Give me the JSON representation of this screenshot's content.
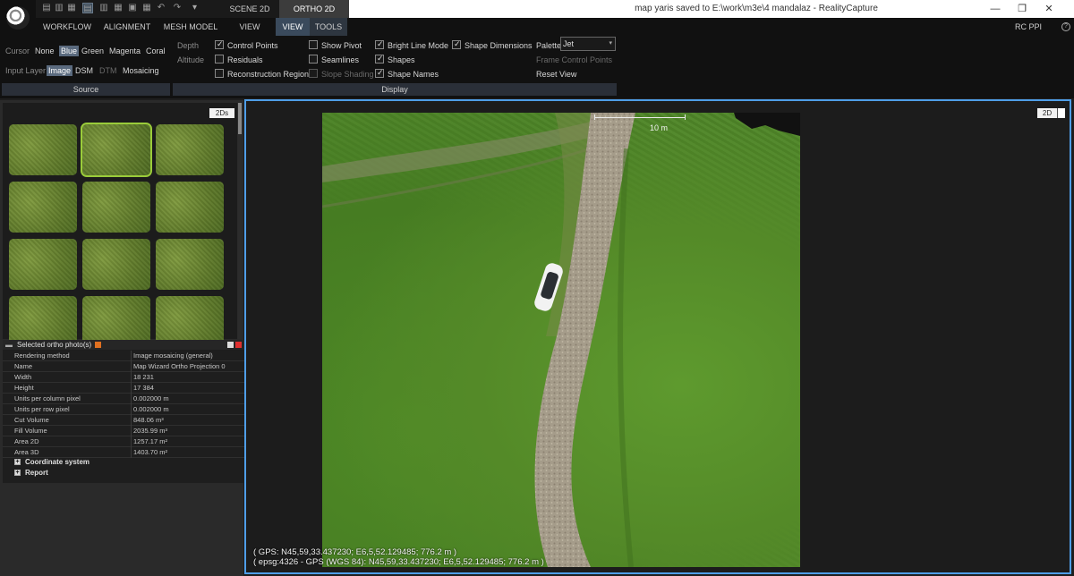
{
  "app": {
    "window_title": "map yaris saved to E:\\work\\m3e\\4 mandalaz - RealityCapture",
    "doc_tabs": [
      "SCENE 2D",
      "ORTHO 2D"
    ],
    "window_controls": {
      "minimize": "—",
      "restore": "❐",
      "close": "✕"
    },
    "quick_icons": [
      "layout-1-icon",
      "layout-2-icon",
      "layout-3-icon",
      "layout-4-icon",
      "layout-5-icon",
      "layout-6-icon",
      "undo-icon",
      "redo-icon"
    ],
    "quick_pin": "▾"
  },
  "ribbon": {
    "tabs": [
      "WORKFLOW",
      "ALIGNMENT",
      "MESH MODEL",
      "VIEW",
      "VIEW",
      "TOOLS"
    ],
    "active_tab": "VIEW",
    "right_label": "RC PPI",
    "help_glyph": "?",
    "source": {
      "cursor_label": "Cursor",
      "cursor_options": [
        "None",
        "Blue",
        "Green",
        "Magenta",
        "Coral"
      ],
      "cursor_selected": "Blue",
      "input_layer_label": "Input Layer",
      "input_layer_options": [
        "Image",
        "DSM",
        "DTM",
        "Mosaicing"
      ],
      "input_layer_selected": "Image",
      "footer": "Source"
    },
    "display": {
      "depth_label": "Depth",
      "altitude_label": "Altitude",
      "checkboxes_col1": [
        {
          "label": "Control Points",
          "checked": true
        },
        {
          "label": "Residuals",
          "checked": false
        },
        {
          "label": "Reconstruction Region",
          "checked": false
        }
      ],
      "checkboxes_col2": [
        {
          "label": "Show Pivot",
          "checked": false
        },
        {
          "label": "Seamlines",
          "checked": false
        },
        {
          "label": "Slope Shading",
          "checked": false,
          "disabled": true
        }
      ],
      "checkboxes_col3": [
        {
          "label": "Bright Line Mode",
          "checked": true
        },
        {
          "label": "Shapes",
          "checked": true
        },
        {
          "label": "Shape Names",
          "checked": true
        }
      ],
      "shape_dimensions": {
        "label": "Shape Dimensions",
        "checked": true
      },
      "palette_label": "Palette",
      "palette_value": "Jet",
      "frame_control_points": "Frame Control Points",
      "reset_view": "Reset View",
      "footer": "Display"
    }
  },
  "left_panel": {
    "thumbs_button": "2Ds",
    "thumbnail_count": 15,
    "selected_thumbnail": 1,
    "properties_title": "Selected ortho photo(s)",
    "properties": [
      {
        "key": "Rendering method",
        "value": "Image mosaicing (general)"
      },
      {
        "key": "Name",
        "value": "Map Wizard Ortho Projection 0"
      },
      {
        "key": "Width",
        "value": "18 231"
      },
      {
        "key": "Height",
        "value": "17 384"
      },
      {
        "key": "Units per column pixel",
        "value": "0.002000 m"
      },
      {
        "key": "Units per row pixel",
        "value": "0.002000 m"
      },
      {
        "key": "Cut Volume",
        "value": "848.06 m³"
      },
      {
        "key": "Fill Volume",
        "value": "2035.99 m³"
      },
      {
        "key": "Area 2D",
        "value": "1257.17 m²"
      },
      {
        "key": "Area 3D",
        "value": "1403.70 m²"
      }
    ],
    "expanders": [
      "Coordinate system",
      "Report"
    ]
  },
  "main_view": {
    "view_button": "2D",
    "scale_label": "10 m",
    "gps_line1": "( GPS: N45,59,33.437230; E6,5,52.129485; 776.2 m )",
    "gps_line2": "( epsg:4326 - GPS (WGS 84): N45,59,33.437230; E6,5,52.129485; 776.2 m )"
  }
}
